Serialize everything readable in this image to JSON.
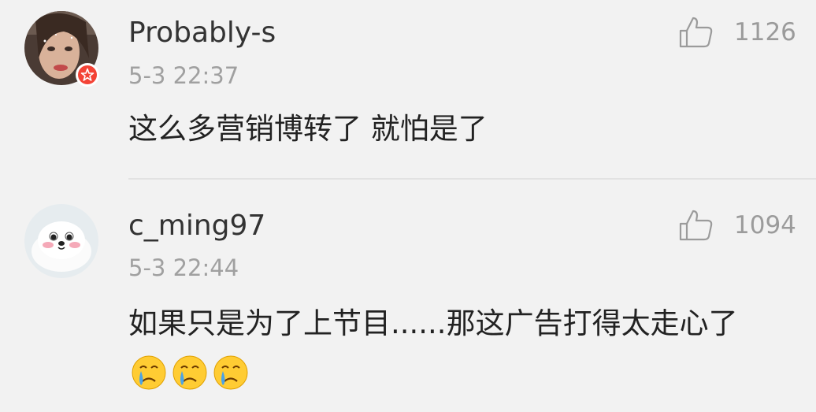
{
  "comments": [
    {
      "username": "Probably-s",
      "time": "5-3 22:37",
      "text": "这么多营销博转了 就怕是了",
      "likes": "1126",
      "avatar": "girl-photo-avatar",
      "badge": "red-star-badge"
    },
    {
      "username": "c_ming97",
      "time": "5-3 22:44",
      "text": "如果只是为了上节目......那这广告打得太走心了",
      "likes": "1094",
      "avatar": "seal-avatar",
      "emojis": [
        "crying-face-emoji",
        "crying-face-emoji",
        "crying-face-emoji"
      ]
    }
  ],
  "colors": {
    "background": "#f2f2f2",
    "username": "#333333",
    "time": "#a0a0a0",
    "body_text": "#222222",
    "like": "#9b9b9b",
    "badge": "#f44336"
  }
}
